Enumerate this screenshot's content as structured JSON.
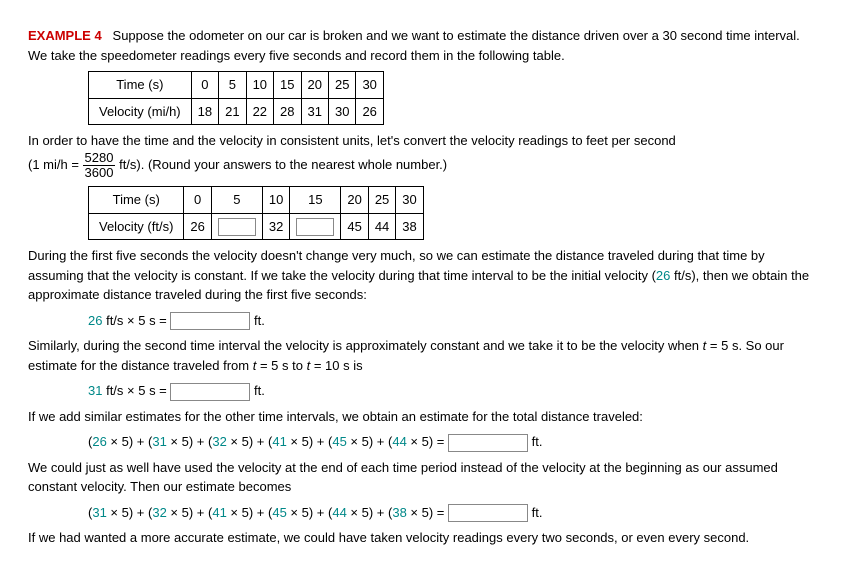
{
  "header": {
    "example_label": "EXAMPLE 4",
    "intro": "Suppose the odometer on our car is broken and we want to estimate the distance driven over a 30 second time interval. We take the speedometer readings every five seconds and record them in the following table."
  },
  "table1": {
    "row1_label": "Time (s)",
    "row1": [
      "0",
      "5",
      "10",
      "15",
      "20",
      "25",
      "30"
    ],
    "row2_label": "Velocity (mi/h)",
    "row2": [
      "18",
      "21",
      "22",
      "28",
      "31",
      "30",
      "26"
    ]
  },
  "conversion": {
    "line1": "In order to have the time and the velocity in consistent units, let's convert the velocity readings to feet per second",
    "prefix": "(1 mi/h = ",
    "frac_num": "5280",
    "frac_den": "3600",
    "suffix": " ft/s).  (Round your answers to the nearest whole number.)"
  },
  "table2": {
    "row1_label": "Time (s)",
    "row1": [
      "0",
      "5",
      "10",
      "15",
      "20",
      "25",
      "30"
    ],
    "row2_label": "Velocity (ft/s)",
    "v0": "26",
    "v10": "32",
    "v20": "45",
    "v25": "44",
    "v30": "38"
  },
  "para1": {
    "text_a": "During the first five seconds the velocity doesn't change very much, so we can estimate the distance traveled during that time by assuming that the velocity is constant. If we take the velocity during that time interval to be the initial velocity  (",
    "teal1": "26",
    "text_b": " ft/s),  then we obtain the approximate distance traveled during the first five seconds:"
  },
  "calc1": {
    "teal": "26",
    "rest": " ft/s × 5 s = ",
    "unit": " ft."
  },
  "para2": {
    "text_a": "Similarly, during the second time interval the velocity is approximately constant and we take it to be the velocity when  ",
    "t_eq": "t",
    "text_b": " = 5 s.  So our estimate for the distance traveled from  ",
    "text_c": " = 5 s  to  ",
    "text_d": " = 10 s  is"
  },
  "calc2": {
    "teal": "31",
    "rest": " ft/s × 5 s = ",
    "unit": " ft."
  },
  "para3": "If we add similar estimates for the other time intervals, we obtain an estimate for the total distance traveled:",
  "sum1": {
    "p1a": "(",
    "p1t": "26",
    "p1b": " × 5) + (",
    "p2t": "31",
    "p2b": " × 5) + (",
    "p3t": "32",
    "p3b": " × 5) + (",
    "p4t": "41",
    "p4b": " × 5) + (",
    "p5t": "45",
    "p5b": " × 5) + (",
    "p6t": "44",
    "p6b": " × 5) = ",
    "unit": " ft."
  },
  "para4": "We could just as well have used the velocity at the end of each time period instead of the velocity at the beginning as our assumed constant velocity. Then our estimate becomes",
  "sum2": {
    "p1a": "(",
    "p1t": "31",
    "p1b": " × 5) + (",
    "p2t": "32",
    "p2b": " × 5) + (",
    "p3t": "41",
    "p3b": " × 5) + (",
    "p4t": "45",
    "p4b": " × 5) + (",
    "p5t": "44",
    "p5b": " × 5) + (",
    "p6t": "38",
    "p6b": " × 5) = ",
    "unit": " ft."
  },
  "para5": "If we had wanted a more accurate estimate, we could have taken velocity readings every two seconds, or even every second.",
  "chart_data": {
    "type": "table",
    "tables": [
      {
        "title": "Speedometer readings",
        "columns": [
          "Time (s)",
          "Velocity (mi/h)"
        ],
        "rows": [
          [
            0,
            18
          ],
          [
            5,
            21
          ],
          [
            10,
            22
          ],
          [
            15,
            28
          ],
          [
            20,
            31
          ],
          [
            25,
            30
          ],
          [
            30,
            26
          ]
        ]
      },
      {
        "title": "Converted velocity",
        "columns": [
          "Time (s)",
          "Velocity (ft/s)"
        ],
        "rows": [
          [
            0,
            26
          ],
          [
            5,
            null
          ],
          [
            10,
            32
          ],
          [
            15,
            null
          ],
          [
            20,
            45
          ],
          [
            25,
            44
          ],
          [
            30,
            38
          ]
        ]
      }
    ]
  }
}
